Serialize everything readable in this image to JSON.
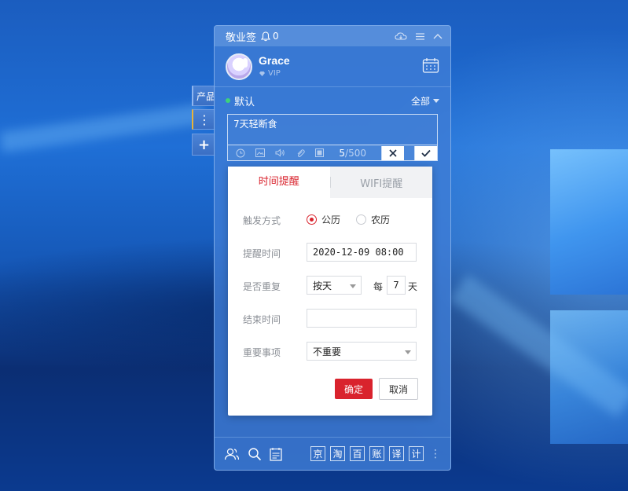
{
  "app": {
    "title": "敬业签",
    "notification_count": "0"
  },
  "side_tabs": {
    "product": "产品",
    "more": "⋮",
    "add": "+"
  },
  "user": {
    "name": "Grace",
    "badge": "VIP"
  },
  "folder": {
    "name": "默认",
    "filter": "全部"
  },
  "editor": {
    "text": "7天轻断食",
    "count": "5",
    "max": "/500"
  },
  "dialog": {
    "tabs": [
      {
        "label": "时间提醒",
        "active": true
      },
      {
        "label": "WIFI提醒",
        "active": false
      }
    ],
    "trigger_label": "触发方式",
    "calendar_options": [
      "公历",
      "农历"
    ],
    "selected_calendar": "公历",
    "remind_time_label": "提醒时间",
    "remind_time_value": "2020-12-09 08:00",
    "repeat_label": "是否重复",
    "repeat_value": "按天",
    "every_label": "每",
    "every_value": "7",
    "every_unit": "天",
    "end_time_label": "结束时间",
    "end_time_value": "",
    "importance_label": "重要事项",
    "importance_value": "不重要",
    "confirm": "确定",
    "cancel": "取消"
  },
  "shortcuts": [
    "京",
    "淘",
    "百",
    "账",
    "译",
    "计"
  ],
  "colors": {
    "accent": "#d9232d",
    "panel": "#3e7cd6",
    "status_dot": "#3ed27a"
  }
}
